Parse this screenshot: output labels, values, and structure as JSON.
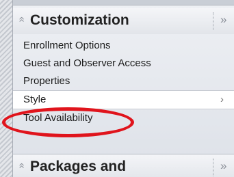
{
  "sections": {
    "customization": {
      "title": "Customization",
      "collapse_icon": "chevron-double-up-icon",
      "expand_icon": "chevron-double-right-icon"
    },
    "packages": {
      "title": "Packages and",
      "collapse_icon": "chevron-double-up-icon",
      "expand_icon": "chevron-double-right-icon"
    }
  },
  "menu": {
    "items": [
      {
        "label": "Enrollment Options"
      },
      {
        "label": "Guest and Observer Access"
      },
      {
        "label": "Properties"
      },
      {
        "label": "Style",
        "selected": true,
        "arrow": "›"
      },
      {
        "label": "Tool Availability"
      }
    ]
  },
  "annotation": {
    "highlight_color": "#e0141c",
    "highlighted_item": "Style"
  },
  "colors": {
    "panel": "#e7e9ed",
    "selected_row": "#ffffff",
    "text": "#1a1a1a"
  }
}
